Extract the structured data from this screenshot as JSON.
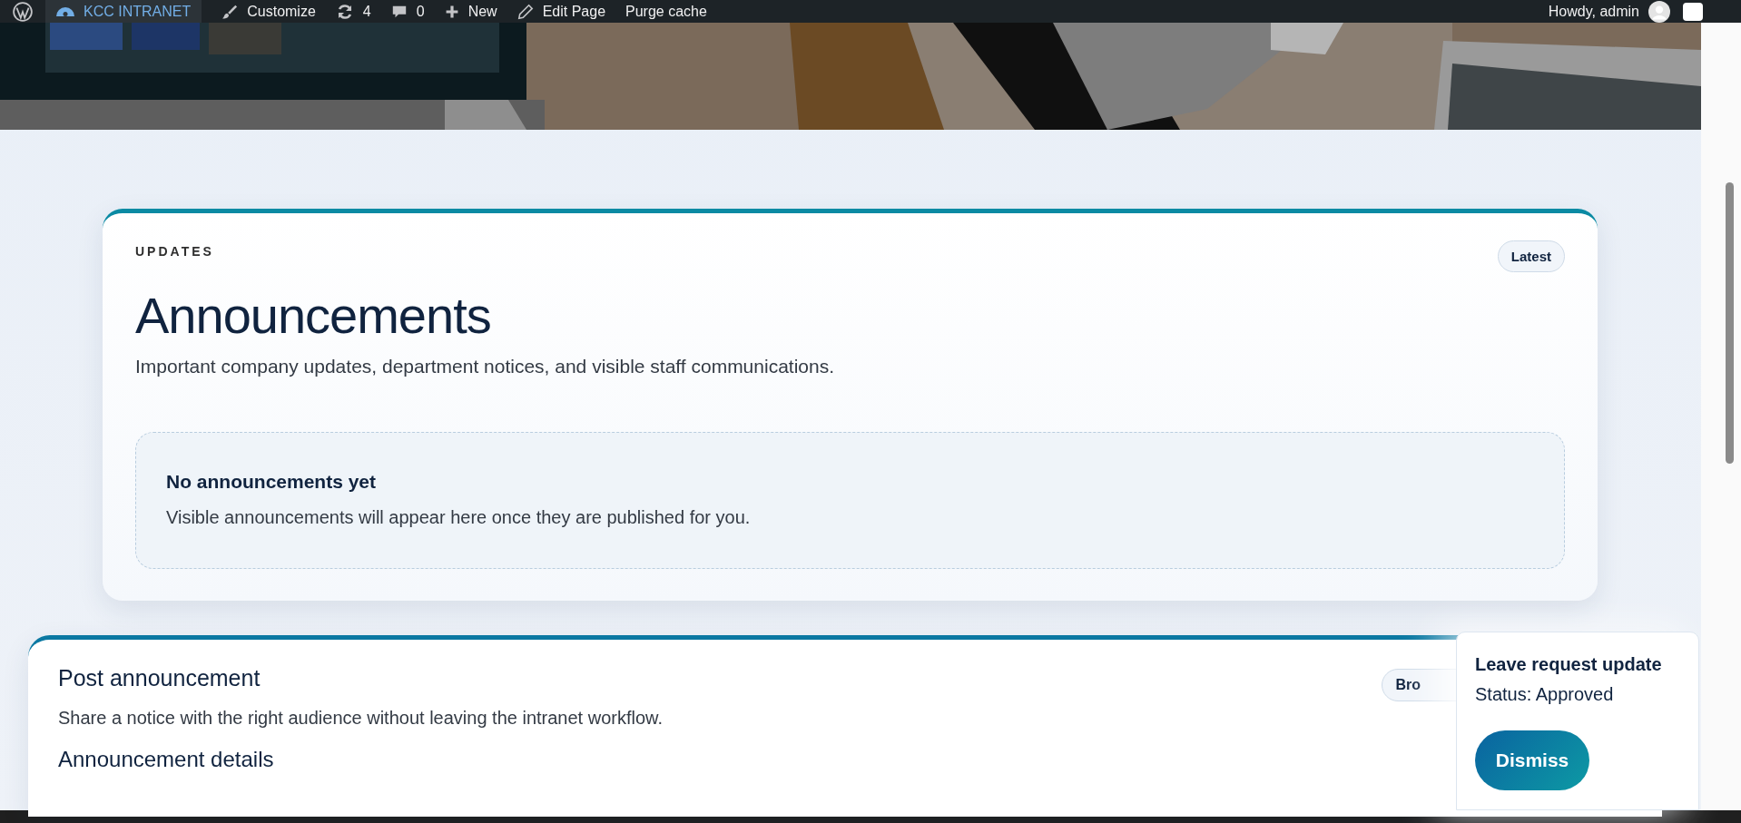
{
  "admin_bar": {
    "site": {
      "label": "KCC INTRANET",
      "selected": true
    },
    "items": [
      {
        "kind": "customize",
        "label": "Customize"
      },
      {
        "kind": "updates",
        "label": "4"
      },
      {
        "kind": "comments",
        "label": "0"
      },
      {
        "kind": "new",
        "label": "New"
      },
      {
        "kind": "edit",
        "label": "Edit Page"
      },
      {
        "kind": "text",
        "label": "Purge cache"
      }
    ],
    "greeting": "Howdy, admin"
  },
  "announcements": {
    "eyebrow": "UPDATES",
    "badge": "Latest",
    "title": "Announcements",
    "subtitle": "Important company updates, department notices, and visible staff communications.",
    "empty_state": {
      "title": "No announcements yet",
      "text": "Visible announcements will appear here once they are published for you."
    }
  },
  "post_announcement": {
    "title": "Post announcement",
    "subtitle": "Share a notice with the right audience without leaving the intranet workflow.",
    "badge": "Bro",
    "section_heading": "Announcement details"
  },
  "toast": {
    "title": "Leave request update",
    "status": "Status: Approved",
    "button": "Dismiss"
  }
}
